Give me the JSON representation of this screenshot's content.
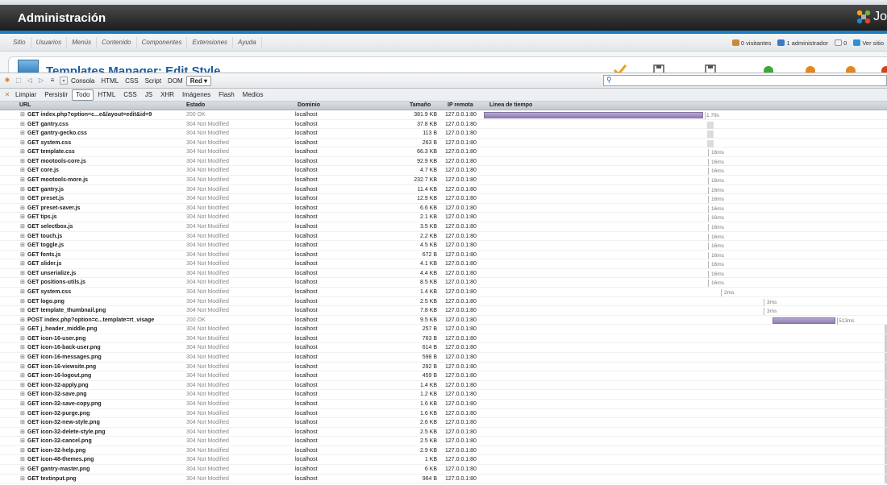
{
  "admin": {
    "title": "Administración",
    "logo_text": "Jo"
  },
  "menu": {
    "items": [
      "Sitio",
      "Usuarios",
      "Menús",
      "Contenido",
      "Componentes",
      "Extensiones",
      "Ayuda"
    ]
  },
  "status": {
    "visitors": "0 visitantes",
    "admins": "1 administrador",
    "messages": "0",
    "view_site": "Ver sitio"
  },
  "page": {
    "title": "Templates Manager: Edit Style"
  },
  "firebug": {
    "tabs": [
      "Consola",
      "HTML",
      "CSS",
      "Script",
      "DOM"
    ],
    "active_tab": "Red ▾",
    "search_placeholder": ""
  },
  "net": {
    "buttons": [
      "Limpiar",
      "Persistir"
    ],
    "filters": [
      "Todo",
      "HTML",
      "CSS",
      "JS",
      "XHR",
      "Imágenes",
      "Flash",
      "Medios"
    ]
  },
  "columns": {
    "url": "URL",
    "status": "Estado",
    "domain": "Dominio",
    "size": "Tamaño",
    "ip": "IP remota",
    "timeline": "Línea de tiempo"
  },
  "requests": [
    {
      "url": "GET index.php?option=c...e&layout=edit&id=9",
      "status": "200 OK",
      "domain": "localhost",
      "size": "381.9 KB",
      "ip": "127.0.0.1:80",
      "dur": "1.79s"
    },
    {
      "url": "GET gantry.css",
      "status": "304 Not Modified",
      "domain": "localhost",
      "size": "37.8 KB",
      "ip": "127.0.0.1:80",
      "dur": ""
    },
    {
      "url": "GET gantry-gecko.css",
      "status": "304 Not Modified",
      "domain": "localhost",
      "size": "113 B",
      "ip": "127.0.0.1:80",
      "dur": ""
    },
    {
      "url": "GET system.css",
      "status": "304 Not Modified",
      "domain": "localhost",
      "size": "263 B",
      "ip": "127.0.0.1:80",
      "dur": ""
    },
    {
      "url": "GET template.css",
      "status": "304 Not Modified",
      "domain": "localhost",
      "size": "66.3 KB",
      "ip": "127.0.0.1:80",
      "dur": "16ms"
    },
    {
      "url": "GET mootools-core.js",
      "status": "304 Not Modified",
      "domain": "localhost",
      "size": "92.9 KB",
      "ip": "127.0.0.1:80",
      "dur": "16ms"
    },
    {
      "url": "GET core.js",
      "status": "304 Not Modified",
      "domain": "localhost",
      "size": "4.7 KB",
      "ip": "127.0.0.1:80",
      "dur": "16ms"
    },
    {
      "url": "GET mootools-more.js",
      "status": "304 Not Modified",
      "domain": "localhost",
      "size": "232.7 KB",
      "ip": "127.0.0.1:80",
      "dur": "16ms"
    },
    {
      "url": "GET gantry.js",
      "status": "304 Not Modified",
      "domain": "localhost",
      "size": "11.4 KB",
      "ip": "127.0.0.1:80",
      "dur": "16ms"
    },
    {
      "url": "GET preset.js",
      "status": "304 Not Modified",
      "domain": "localhost",
      "size": "12.9 KB",
      "ip": "127.0.0.1:80",
      "dur": "16ms"
    },
    {
      "url": "GET preset-saver.js",
      "status": "304 Not Modified",
      "domain": "localhost",
      "size": "6.6 KB",
      "ip": "127.0.0.1:80",
      "dur": "16ms"
    },
    {
      "url": "GET tips.js",
      "status": "304 Not Modified",
      "domain": "localhost",
      "size": "2.1 KB",
      "ip": "127.0.0.1:80",
      "dur": "16ms"
    },
    {
      "url": "GET selectbox.js",
      "status": "304 Not Modified",
      "domain": "localhost",
      "size": "3.5 KB",
      "ip": "127.0.0.1:80",
      "dur": "16ms"
    },
    {
      "url": "GET touch.js",
      "status": "304 Not Modified",
      "domain": "localhost",
      "size": "2.2 KB",
      "ip": "127.0.0.1:80",
      "dur": "16ms"
    },
    {
      "url": "GET toggle.js",
      "status": "304 Not Modified",
      "domain": "localhost",
      "size": "4.5 KB",
      "ip": "127.0.0.1:80",
      "dur": "16ms"
    },
    {
      "url": "GET fonts.js",
      "status": "304 Not Modified",
      "domain": "localhost",
      "size": "672 B",
      "ip": "127.0.0.1:80",
      "dur": "16ms"
    },
    {
      "url": "GET slider.js",
      "status": "304 Not Modified",
      "domain": "localhost",
      "size": "4.1 KB",
      "ip": "127.0.0.1:80",
      "dur": "16ms"
    },
    {
      "url": "GET unserialize.js",
      "status": "304 Not Modified",
      "domain": "localhost",
      "size": "4.4 KB",
      "ip": "127.0.0.1:80",
      "dur": "16ms"
    },
    {
      "url": "GET positions-utils.js",
      "status": "304 Not Modified",
      "domain": "localhost",
      "size": "8.5 KB",
      "ip": "127.0.0.1:80",
      "dur": "16ms"
    },
    {
      "url": "GET system.css",
      "status": "304 Not Modified",
      "domain": "localhost",
      "size": "1.4 KB",
      "ip": "127.0.0.1:80",
      "dur": "2ms"
    },
    {
      "url": "GET logo.png",
      "status": "304 Not Modified",
      "domain": "localhost",
      "size": "2.5 KB",
      "ip": "127.0.0.1:80",
      "dur": "3ms"
    },
    {
      "url": "GET template_thumbnail.png",
      "status": "304 Not Modified",
      "domain": "localhost",
      "size": "7.8 KB",
      "ip": "127.0.0.1:80",
      "dur": "3ms"
    },
    {
      "url": "POST index.php?option=c...template=rt_visage",
      "status": "200 OK",
      "domain": "localhost",
      "size": "9.5 KB",
      "ip": "127.0.0.1:80",
      "dur": "513ms"
    },
    {
      "url": "GET j_header_middle.png",
      "status": "304 Not Modified",
      "domain": "localhost",
      "size": "257 B",
      "ip": "127.0.0.1:80",
      "dur": ""
    },
    {
      "url": "GET icon-16-user.png",
      "status": "304 Not Modified",
      "domain": "localhost",
      "size": "763 B",
      "ip": "127.0.0.1:80",
      "dur": ""
    },
    {
      "url": "GET icon-16-back-user.png",
      "status": "304 Not Modified",
      "domain": "localhost",
      "size": "614 B",
      "ip": "127.0.0.1:80",
      "dur": ""
    },
    {
      "url": "GET icon-16-messages.png",
      "status": "304 Not Modified",
      "domain": "localhost",
      "size": "598 B",
      "ip": "127.0.0.1:80",
      "dur": ""
    },
    {
      "url": "GET icon-16-viewsite.png",
      "status": "304 Not Modified",
      "domain": "localhost",
      "size": "292 B",
      "ip": "127.0.0.1:80",
      "dur": ""
    },
    {
      "url": "GET icon-16-logout.png",
      "status": "304 Not Modified",
      "domain": "localhost",
      "size": "459 B",
      "ip": "127.0.0.1:80",
      "dur": ""
    },
    {
      "url": "GET icon-32-apply.png",
      "status": "304 Not Modified",
      "domain": "localhost",
      "size": "1.4 KB",
      "ip": "127.0.0.1:80",
      "dur": ""
    },
    {
      "url": "GET icon-32-save.png",
      "status": "304 Not Modified",
      "domain": "localhost",
      "size": "1.2 KB",
      "ip": "127.0.0.1:80",
      "dur": ""
    },
    {
      "url": "GET icon-32-save-copy.png",
      "status": "304 Not Modified",
      "domain": "localhost",
      "size": "1.6 KB",
      "ip": "127.0.0.1:80",
      "dur": ""
    },
    {
      "url": "GET icon-32-purge.png",
      "status": "304 Not Modified",
      "domain": "localhost",
      "size": "1.6 KB",
      "ip": "127.0.0.1:80",
      "dur": ""
    },
    {
      "url": "GET icon-32-new-style.png",
      "status": "304 Not Modified",
      "domain": "localhost",
      "size": "2.6 KB",
      "ip": "127.0.0.1:80",
      "dur": ""
    },
    {
      "url": "GET icon-32-delete-style.png",
      "status": "304 Not Modified",
      "domain": "localhost",
      "size": "2.5 KB",
      "ip": "127.0.0.1:80",
      "dur": ""
    },
    {
      "url": "GET icon-32-cancel.png",
      "status": "304 Not Modified",
      "domain": "localhost",
      "size": "2.5 KB",
      "ip": "127.0.0.1:80",
      "dur": ""
    },
    {
      "url": "GET icon-32-help.png",
      "status": "304 Not Modified",
      "domain": "localhost",
      "size": "2.9 KB",
      "ip": "127.0.0.1:80",
      "dur": ""
    },
    {
      "url": "GET icon-48-themes.png",
      "status": "304 Not Modified",
      "domain": "localhost",
      "size": "1 KB",
      "ip": "127.0.0.1:80",
      "dur": ""
    },
    {
      "url": "GET gantry-master.png",
      "status": "304 Not Modified",
      "domain": "localhost",
      "size": "6 KB",
      "ip": "127.0.0.1:80",
      "dur": ""
    },
    {
      "url": "GET textinput.png",
      "status": "304 Not Modified",
      "domain": "localhost",
      "size": "964 B",
      "ip": "127.0.0.1:80",
      "dur": ""
    }
  ]
}
